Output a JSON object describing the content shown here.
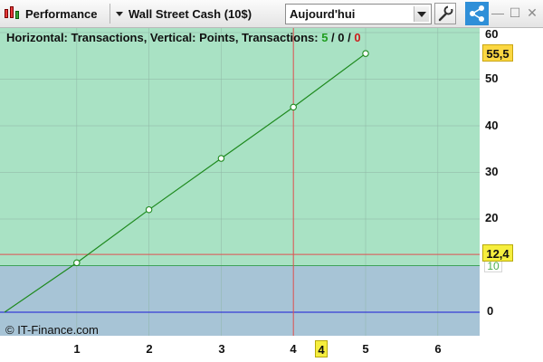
{
  "toolbar": {
    "performance_label": "Performance",
    "instrument_label": "Wall Street Cash (10$)",
    "period_value": "Aujourd'hui",
    "icons": {
      "performance": "candlestick-icon",
      "wrench": "wrench-icon",
      "share": "share-icon",
      "minimize": "minimize-icon",
      "maximize": "maximize-icon",
      "close": "close-icon"
    },
    "window_buttons": [
      "—",
      "☐",
      "✕"
    ]
  },
  "chart": {
    "title_prefix": "Horizontal: Transactions, Vertical: Points, Transactions: ",
    "count_winners": "5",
    "sep1": " / ",
    "count_neutral": "0",
    "sep2": " / ",
    "count_losers": "0",
    "copyright": "© IT-Finance.com",
    "last_value_tag": "55,5",
    "crosshair_y_tag": "12,4",
    "crosshair_x_tag": "4",
    "green_zone_label": "10",
    "y_ticks": [
      "60",
      "50",
      "40",
      "30",
      "20",
      "10",
      "0"
    ],
    "x_ticks": [
      "1",
      "2",
      "3",
      "4",
      "5",
      "6"
    ],
    "colors": {
      "positive_zone": "#a9e2c4",
      "negative_zone": "#a7c4d6",
      "line": "#1e8a1e",
      "zero_line": "#1a1ad6",
      "crosshair": "#e05050",
      "buy": "#1f9d1f",
      "sell": "#cc1b1b"
    }
  },
  "chart_data": {
    "type": "line",
    "title": "Horizontal: Transactions, Vertical: Points, Transactions: 5 / 0 / 0",
    "xlabel": "Transactions",
    "ylabel": "Points",
    "x": [
      0,
      1,
      2,
      3,
      4,
      5
    ],
    "series": [
      {
        "values": [
          0,
          10.6,
          22.0,
          33.0,
          44.0,
          55.5
        ]
      }
    ],
    "xlim": [
      0,
      6.6
    ],
    "ylim": [
      -5,
      61.5
    ],
    "x_ticks": [
      1,
      2,
      3,
      4,
      5,
      6
    ],
    "y_ticks": [
      0,
      10,
      20,
      30,
      40,
      50,
      60
    ],
    "threshold": 10,
    "crosshair": {
      "x": 4,
      "y": 12.4
    },
    "grid": true
  }
}
